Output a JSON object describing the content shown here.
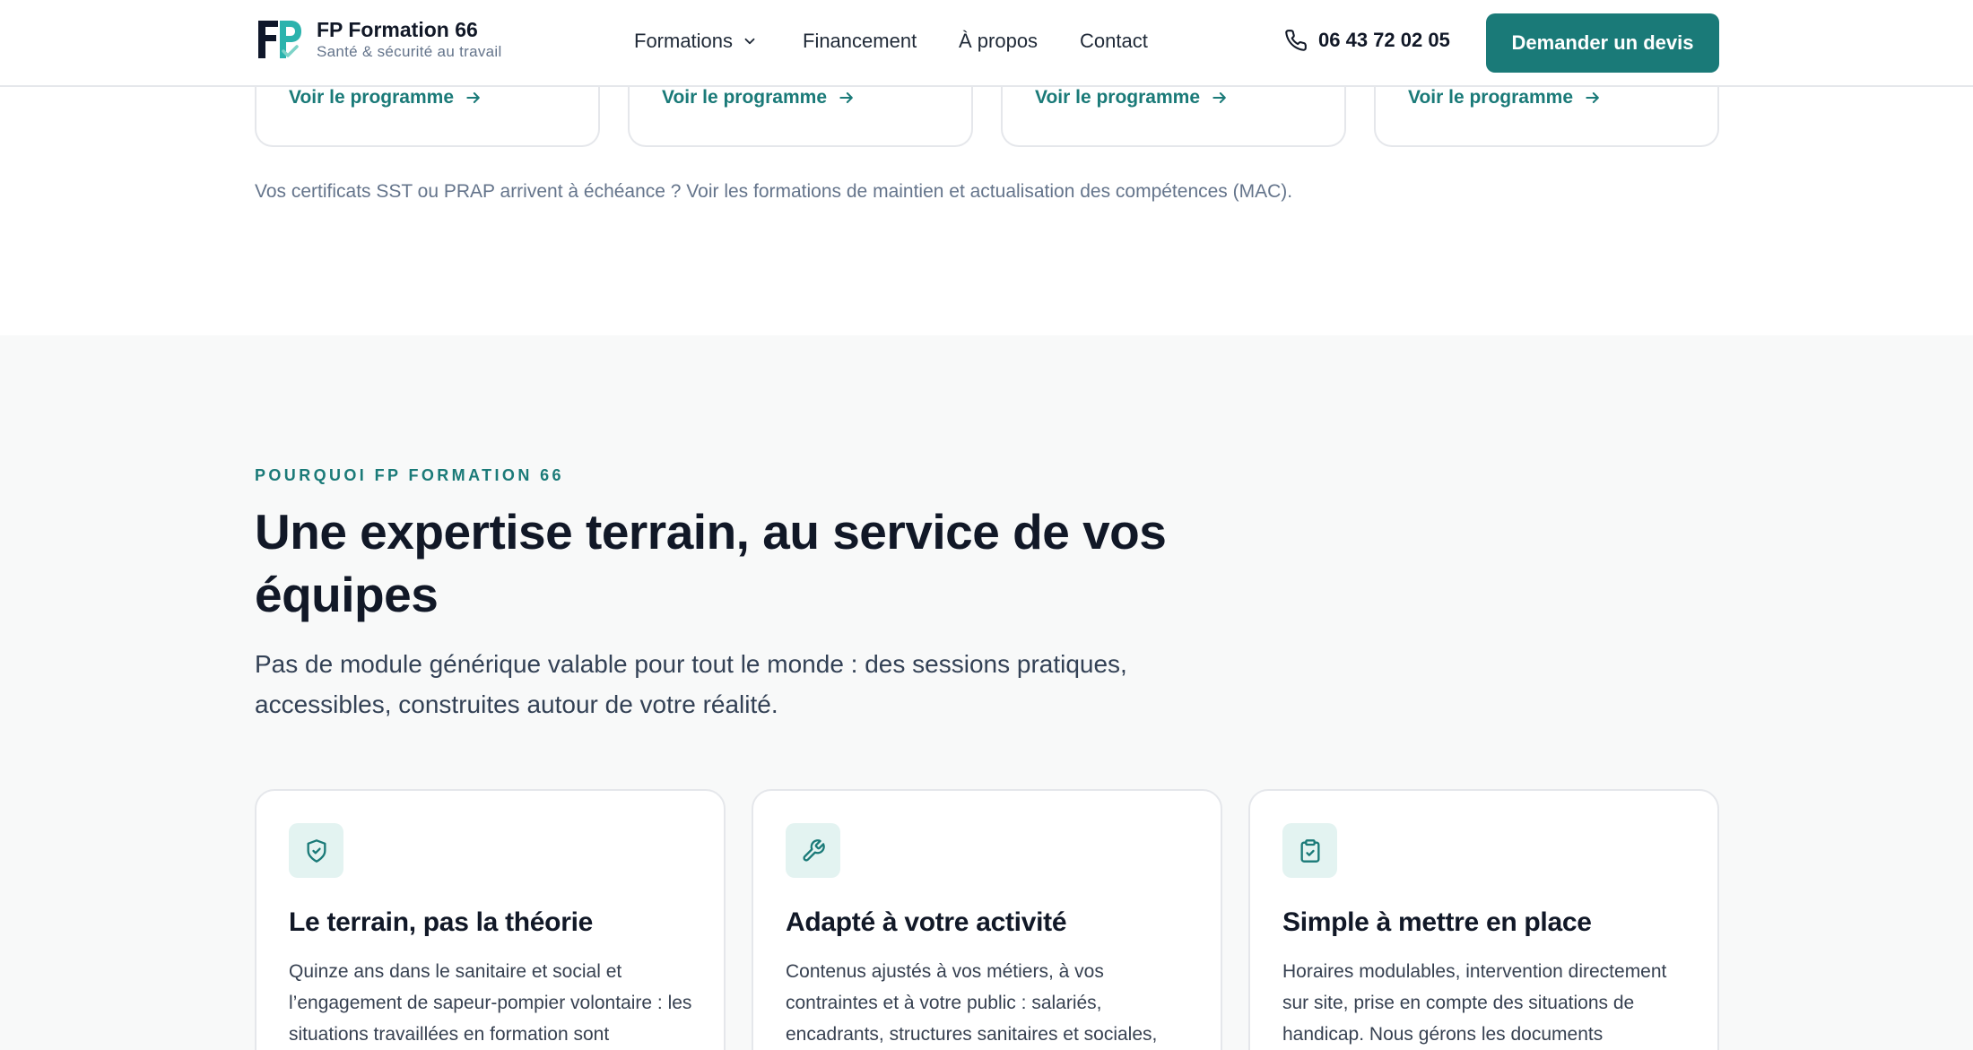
{
  "header": {
    "brand_name": "FP Formation 66",
    "brand_tagline": "Santé & sécurité au travail",
    "nav": {
      "formations": "Formations",
      "financement": "Financement",
      "apropos": "À propos",
      "contact": "Contact"
    },
    "phone": "06 43 72 02 05",
    "cta": "Demander un devis"
  },
  "programme_cards": [
    {
      "link": "Voir le programme"
    },
    {
      "link": "Voir le programme"
    },
    {
      "link": "Voir le programme"
    },
    {
      "link": "Voir le programme"
    }
  ],
  "mac_note": "Vos certificats SST ou PRAP arrivent à échéance ? Voir les formations de maintien et actualisation des compétences (MAC).",
  "why": {
    "eyebrow": "POURQUOI FP FORMATION 66",
    "headline": "Une expertise terrain, au service de vos équipes",
    "lead": "Pas de module générique valable pour tout le monde : des sessions pratiques, accessibles, construites autour de votre réalité.",
    "features": [
      {
        "icon": "shield-check-icon",
        "title": "Le terrain, pas la théorie",
        "text": "Quinze ans dans le sanitaire et social et l’engagement de sapeur-pompier volontaire : les situations travaillées en formation sont"
      },
      {
        "icon": "wrench-icon",
        "title": "Adapté à votre activité",
        "text": "Contenus ajustés à vos métiers, à vos contraintes et à votre public : salariés, encadrants, structures sanitaires et sociales,"
      },
      {
        "icon": "clipboard-check-icon",
        "title": "Simple à mettre en place",
        "text": "Horaires modulables, intervention directement sur site, prise en compte des situations de handicap. Nous gérons les documents"
      }
    ]
  },
  "colors": {
    "accent": "#1a7a78",
    "icon_bg": "#e3f3f1",
    "section_bg": "#f8f9f9"
  }
}
